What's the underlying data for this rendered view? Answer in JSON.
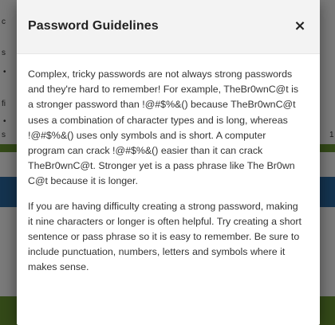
{
  "background": {
    "fragments": [
      "c",
      "s",
      "•",
      "fi",
      "•",
      "s",
      "1"
    ]
  },
  "modal": {
    "title": "Password Guidelines",
    "close_symbol": "×",
    "close_icon": "close-icon",
    "paragraphs": [
      "Complex, tricky passwords are not always strong passwords and they're hard to remember! For example, TheBr0wnC@t is a stronger password than !@#$%&() because TheBr0wnC@t uses a combination of character types and is long, whereas !@#$%&() uses only symbols and is short. A computer program can crack !@#$%&() easier than it can crack TheBr0wnC@t. Stronger yet is a pass phrase like The Br0wn C@t because it is longer.",
      "If you are having difficulty creating a strong password, making it nine characters or longer is often helpful. Try creating a short sentence or pass phrase so it is easy to remember. Be sure to include punctuation, numbers, letters and symbols where it makes sense."
    ]
  },
  "colors": {
    "header_bg": "#f3f3f3",
    "accent_green": "#6b9a32",
    "accent_blue": "#2b6ca6"
  }
}
